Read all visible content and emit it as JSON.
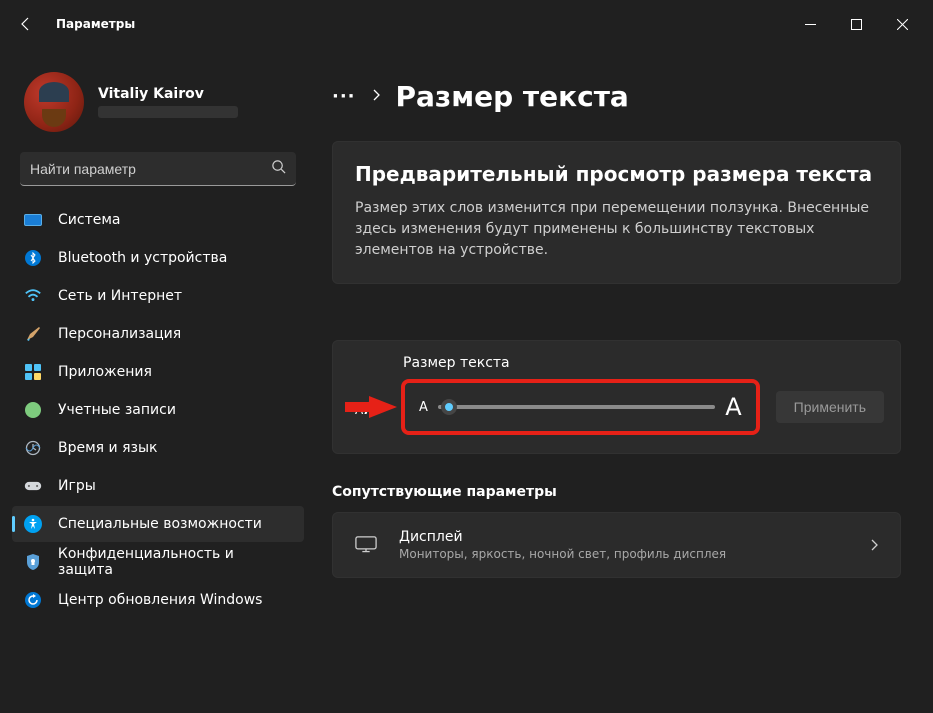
{
  "window": {
    "title": "Параметры"
  },
  "profile": {
    "name": "Vitaliy Kairov"
  },
  "search": {
    "placeholder": "Найти параметр"
  },
  "nav": {
    "system": "Система",
    "bluetooth": "Bluetooth и устройства",
    "network": "Сеть и Интернет",
    "personalization": "Персонализация",
    "apps": "Приложения",
    "accounts": "Учетные записи",
    "time": "Время и язык",
    "gaming": "Игры",
    "accessibility": "Специальные возможности",
    "privacy": "Конфиденциальность и защита",
    "update": "Центр обновления Windows"
  },
  "breadcrumb": {
    "title": "Размер текста"
  },
  "preview": {
    "title": "Предварительный просмотр размера текста",
    "desc": "Размер этих слов изменится при перемещении ползунка. Внесенные здесь изменения будут применены к большинству текстовых элементов на устройстве."
  },
  "textsize": {
    "label": "Размер текста",
    "small": "A",
    "large": "A",
    "apply": "Применить"
  },
  "related": {
    "label": "Сопутствующие параметры",
    "display": {
      "title": "Дисплей",
      "desc": "Мониторы, яркость, ночной свет, профиль дисплея"
    }
  }
}
